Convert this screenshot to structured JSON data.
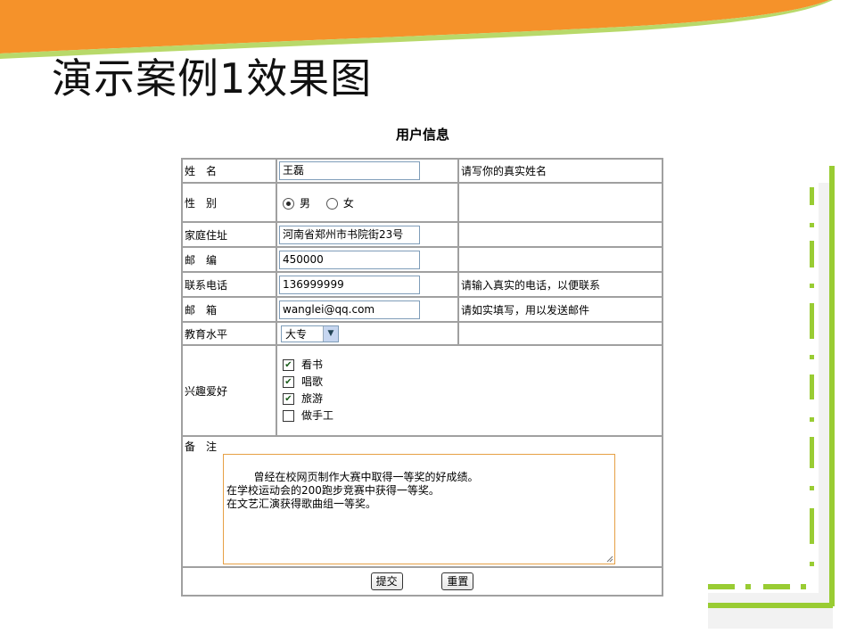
{
  "slide": {
    "title": "演示案例1效果图"
  },
  "form": {
    "caption": "用户信息",
    "rows": {
      "name": {
        "label": "姓　名",
        "value": "王磊",
        "hint": "请写你的真实姓名"
      },
      "gender": {
        "label": "性　别",
        "options": [
          {
            "label": "男",
            "checked": true
          },
          {
            "label": "女",
            "checked": false
          }
        ]
      },
      "address": {
        "label": "家庭住址",
        "value": "河南省郑州市书院街23号"
      },
      "zip": {
        "label": "邮　编",
        "value": "450000"
      },
      "phone": {
        "label": "联系电话",
        "value": "136999999",
        "hint": "请输入真实的电话，以便联系"
      },
      "email": {
        "label": "邮　箱",
        "value": "wanglei@qq.com",
        "hint": "请如实填写，用以发送邮件"
      },
      "education": {
        "label": "教育水平",
        "selected": "大专"
      },
      "hobbies": {
        "label": "兴趣爱好",
        "items": [
          {
            "label": "看书",
            "checked": true
          },
          {
            "label": "唱歌",
            "checked": true
          },
          {
            "label": "旅游",
            "checked": true
          },
          {
            "label": "做手工",
            "checked": false
          }
        ]
      },
      "remarks": {
        "label": "备　注",
        "text": "曾经在校网页制作大赛中取得一等奖的好成绩。\n在学校运动会的200跑步竞赛中获得一等奖。\n在文艺汇演获得歌曲组一等奖。"
      }
    },
    "buttons": {
      "submit": "提交",
      "reset": "重置"
    }
  },
  "colors": {
    "orange": "#f5922a",
    "green": "#99cc33",
    "border": "#a0a0a0",
    "textarea_border": "#e6a045"
  }
}
